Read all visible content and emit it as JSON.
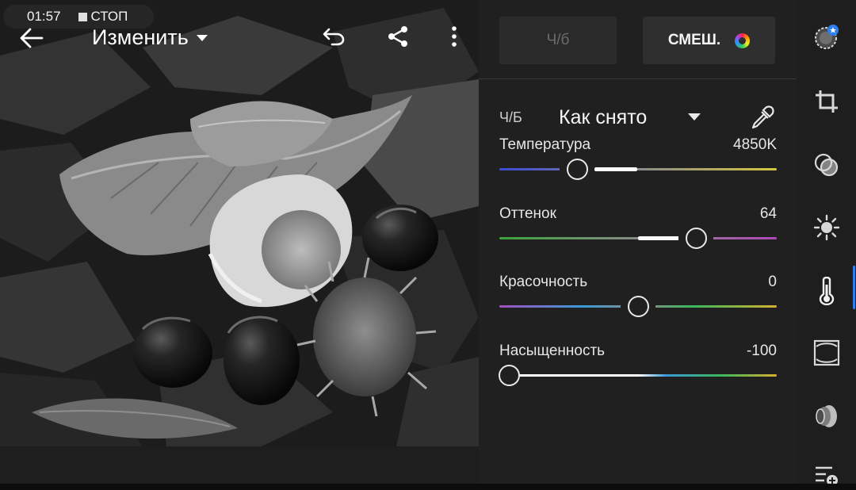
{
  "status": {
    "time": "01:57",
    "recording": "СТОП"
  },
  "topbar": {
    "title": "Изменить",
    "icons": [
      "back-arrow-icon",
      "undo-icon",
      "share-icon",
      "more-vert-icon"
    ]
  },
  "panel": {
    "bw_button": "Ч/б",
    "mix_button": "СМЕШ.",
    "profile": {
      "label": "Ч/Б",
      "value": "Как снято"
    },
    "sliders": [
      {
        "label": "Температура",
        "value": "4850K",
        "position": 0.28
      },
      {
        "label": "Оттенок",
        "value": "64",
        "position": 0.71
      },
      {
        "label": "Красочность",
        "value": "0",
        "position": 0.5
      },
      {
        "label": "Насыщенность",
        "value": "-100",
        "position": 0.0
      }
    ]
  },
  "rail": {
    "icons": [
      "presets-icon",
      "crop-icon",
      "mixer-icon",
      "light-icon",
      "color-temperature-icon",
      "vignette-icon",
      "lens-icon",
      "adjust-more-icon"
    ],
    "active": "color-temperature-icon",
    "accent": "#2d7ff0"
  }
}
